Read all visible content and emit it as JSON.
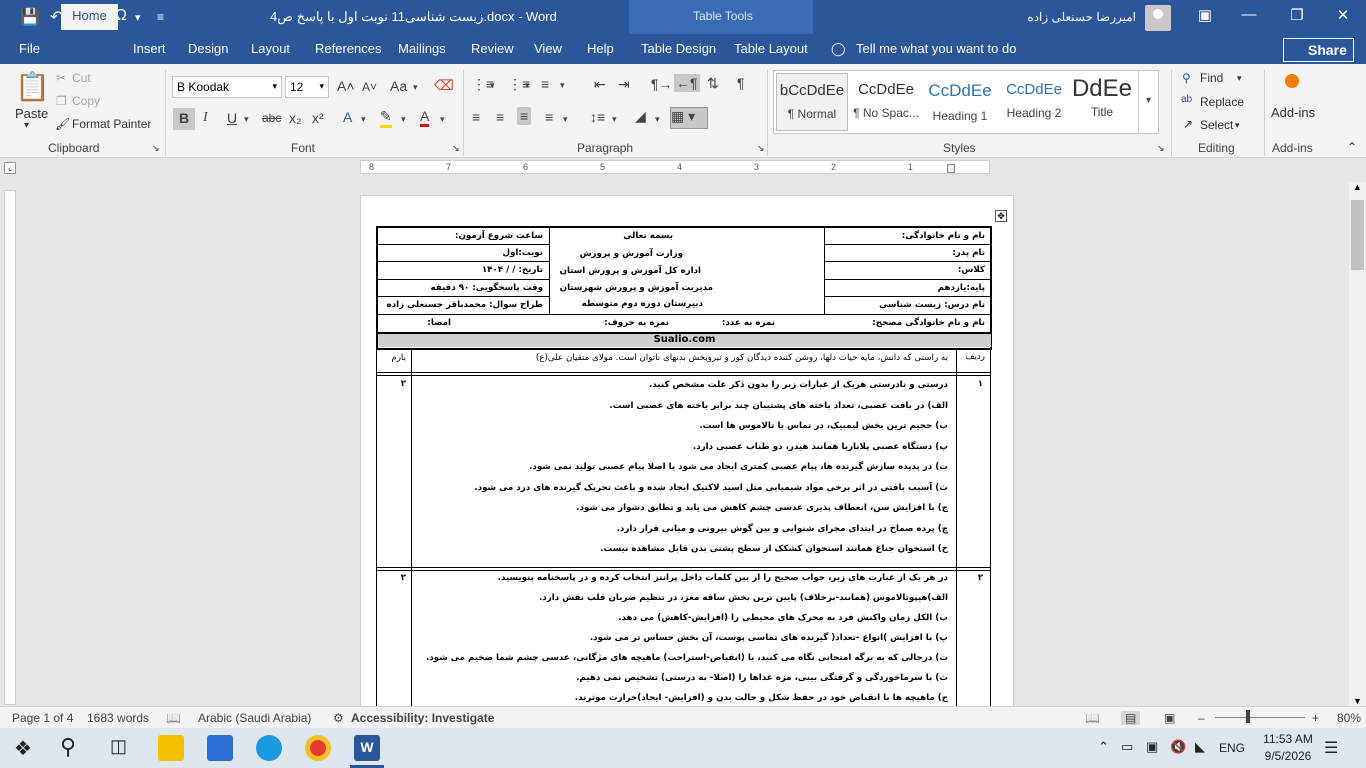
{
  "window": {
    "title": "زیست شناسی11 نوبت اول با پاسخ ص4.docx  -  Word",
    "contextual_tab_group": "Table Tools",
    "user": "امیررضا حسنعلی زاده",
    "tell_me": "Tell me what you want to do",
    "share": "Share"
  },
  "tabs": [
    "File",
    "Home",
    "Insert",
    "Design",
    "Layout",
    "References",
    "Mailings",
    "Review",
    "View",
    "Help",
    "Table Design",
    "Table Layout"
  ],
  "active_tab": "Home",
  "ribbon": {
    "clipboard": {
      "label": "Clipboard",
      "paste": "Paste",
      "cut": "Cut",
      "copy": "Copy",
      "format_painter": "Format Painter"
    },
    "font": {
      "label": "Font",
      "name": "B Koodak",
      "size": "12"
    },
    "paragraph": {
      "label": "Paragraph"
    },
    "styles": {
      "label": "Styles",
      "items": [
        {
          "preview": "bCcDdEe",
          "name": "¶ Normal"
        },
        {
          "preview": "CcDdEe",
          "name": "¶ No Spac..."
        },
        {
          "preview": "CcDdEe",
          "name": "Heading 1"
        },
        {
          "preview": "CcDdEe",
          "name": "Heading 2"
        },
        {
          "preview": "DdEe",
          "name": "Title"
        }
      ]
    },
    "editing": {
      "label": "Editing",
      "find": "Find",
      "replace": "Replace",
      "select": "Select"
    },
    "addins": {
      "label": "Add-ins",
      "button": "Add-ins"
    }
  },
  "ruler": {
    "marks": [
      "8",
      "7",
      "6",
      "5",
      "4",
      "3",
      "2",
      "1"
    ]
  },
  "document": {
    "header_right": [
      "نام و نام خانوادگی:",
      "نام پدر:",
      "کلاس:",
      "پایه:یازدهم",
      "نام درس: زیست شناسی"
    ],
    "header_center": [
      "بسمه تعالی",
      "وزارت آموزش و پرورش",
      "اداره کل آموزش و پرورش استان",
      "مدیریت آموزش و پرورش شهرستان",
      "دبیرستان دوره دوم متوسطه"
    ],
    "header_left": [
      "ساعت شروع آزمون:",
      "نوبت:اول",
      "تاریخ:    /    /   ۱۴۰۴",
      "وقت پاسخگویی: ۹۰ دقیقه",
      "طراح سوال: محمدباقر حسنعلی زاده"
    ],
    "corrector_row": {
      "name": "نام و نام خانوادگی مصحح:",
      "num_grade": "نمره به عدد:",
      "word_grade": "نمره به حروف:",
      "sign": "امضا:"
    },
    "watermark": "Sualio.com",
    "col_headers": {
      "row": "ردیف",
      "score": "بارم",
      "quote": "به راستی که دانش، مایه حیات دلها، روشن کننده دیدگان کور و نیروبخش بدنهای ناتوان است. مولای متقیان علی(ع)"
    },
    "q1": {
      "num": "۱",
      "score": "۲",
      "lines": [
        "درستی و نادرستی هریک از عبارات زیر را بدون ذکر علت مشخص کنید.",
        "الف) در بافت عصبی، تعداد یاخته های پشتیبان چند برابر یاخته های عصبی است.",
        "ب) حجیم ترین بخش لیمبیک، در تماس با تالاموس ها است.",
        "پ) دستگاه عصبی پلاناریا همانند هیدر، دو طناب عصبی دارد.",
        "ت) در پدیده سازش گیرنده ها، پیام عصبی کمتری ایجاد می شود یا اصلا پیام عصبی تولید نمی شود.",
        "ث) آسیب بافتی در اثر برخی مواد شیمیایی مثل اسید لاکتیک ایجاد شده و باعث تحریک گیرنده های درد می شود.",
        "ج) با افزایش سن، انعطاف پذیری عدسی چشم کاهش می یابد و تطابق دشوار می شود.",
        "چ) پرده صماخ در ابتدای مجرای شنوایی و بین گوش بیرونی و میانی قرار دارد.",
        "ح) استخوان جناغ همانند استخوان کشکک از سطح پشتی بدن قابل مشاهده نیست."
      ]
    },
    "q2": {
      "num": "۲",
      "score": "۲",
      "lines": [
        "در هر یک از عبارت های زیر، جواب صحیح را از بین کلمات داخل پرانتز انتخاب کرده و در پاسخنامه بنویسید.",
        "الف)هیپوتالاموس (همانند-برخلاف) پایین ترین بخش ساقه مغز، در تنظیم ضربان قلب نقش دارد.",
        "ب) الکل زمان واکنش فرد به محرک های محیطی را (افزایش-کاهش) می دهد.",
        "پ) با افزایش )انواع -تعداد( گیرنده های تماسی پوست، آن بخش حساس تر می شود.",
        "ت) درحالی که به برگه امتحانی نگاه می کنید، با (انقباض-استراحت) ماهیچه های مژگانی، عدسی چشم شما ضخیم می شود.",
        "ث) با سرماخوردگی و گرفتگی بینی، مزه غذاها را (اصلا- به درستی) تشخیص نمی دهیم.",
        "ج) ماهیچه ها با انقباض خود در حفظ شکل و حالت بدن و (افزایش- ایجاد)حرارت موثرند."
      ]
    }
  },
  "status": {
    "page": "Page 1 of 4",
    "words": "1683 words",
    "language": "Arabic (Saudi Arabia)",
    "accessibility": "Accessibility: Investigate",
    "zoom": "80%"
  },
  "taskbar": {
    "time": "11:53 AM",
    "date": "9/5/2026",
    "lang": "ENG"
  }
}
